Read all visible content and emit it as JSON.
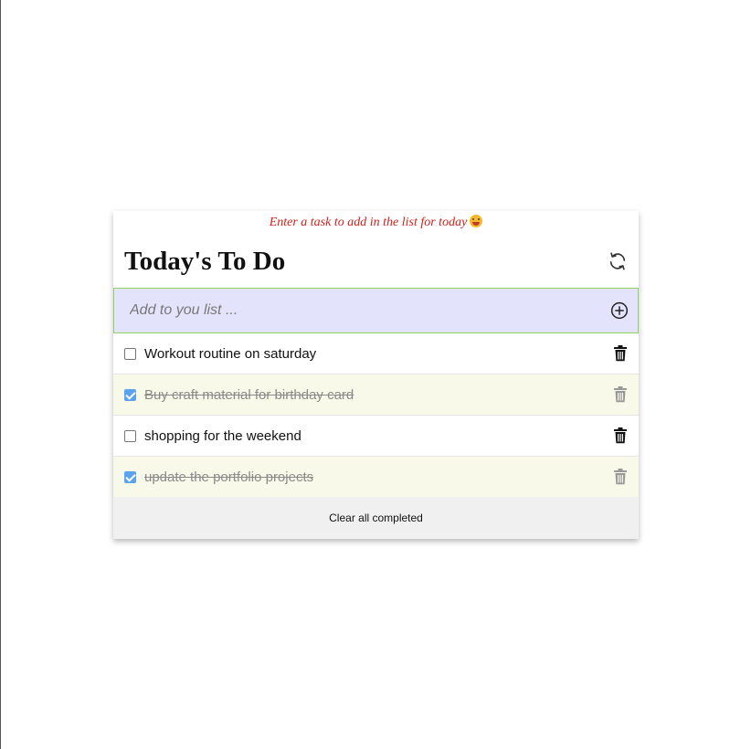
{
  "hint": {
    "text": "Enter a task to add in the list for today"
  },
  "header": {
    "title": "Today's To Do"
  },
  "add": {
    "placeholder": "Add to you list ..."
  },
  "tasks": [
    {
      "label": "Workout routine on saturday",
      "completed": false
    },
    {
      "label": "Buy craft material for birthday card",
      "completed": true
    },
    {
      "label": "shopping for the weekend",
      "completed": false
    },
    {
      "label": "update the portfolio projects",
      "completed": true
    }
  ],
  "footer": {
    "clear_label": "Clear all completed"
  },
  "colors": {
    "hint_text": "#d0201a",
    "input_bg": "#e3e3fb",
    "input_border": "#8fd46a",
    "completed_bg": "#f8f9e9",
    "checkbox_checked": "#5ba3f0"
  }
}
